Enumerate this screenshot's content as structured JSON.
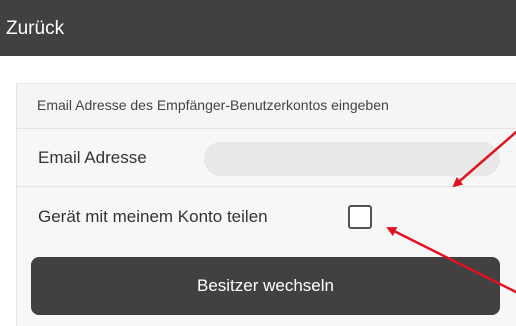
{
  "header": {
    "back_label": "Zurück"
  },
  "form": {
    "title": "Email Adresse des Empfänger-Benutzerkontos eingeben",
    "email_label": "Email Adresse",
    "email_value": "",
    "share_label": "Gerät mit meinem Konto teilen",
    "share_checked": false,
    "submit_label": "Besitzer wechseln"
  },
  "colors": {
    "topbar": "#414141",
    "button": "#414141",
    "annotation_arrow": "#e0141e"
  }
}
